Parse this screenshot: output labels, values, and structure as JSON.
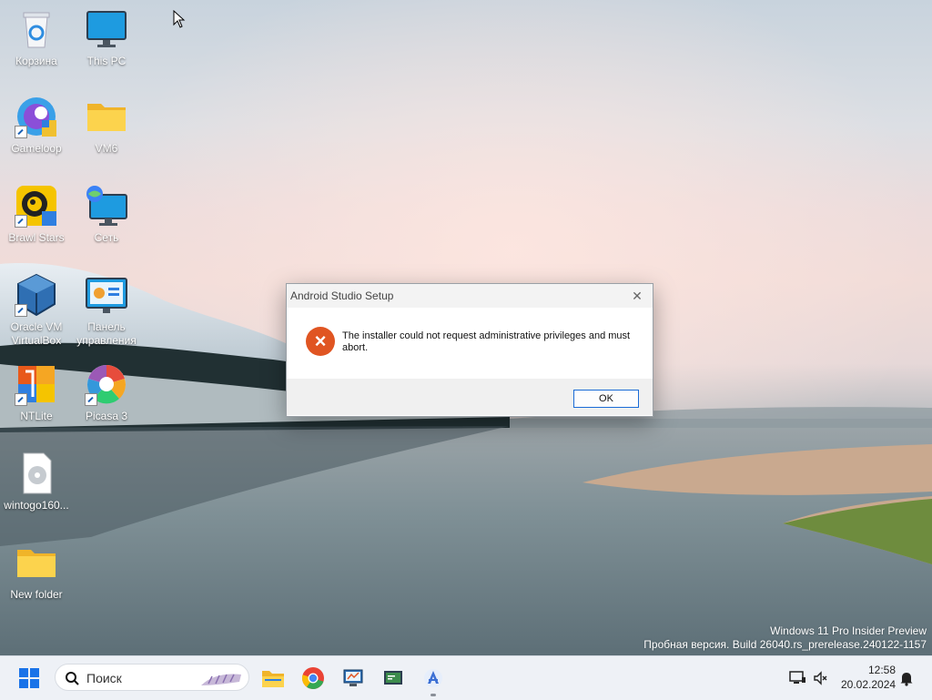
{
  "desktop": {
    "icons": [
      {
        "label": "Корзина",
        "icon": "recycle-bin-icon"
      },
      {
        "label": "This PC",
        "icon": "monitor-icon"
      },
      {
        "label": "Gameloop",
        "icon": "gameloop-icon"
      },
      {
        "label": "VM6",
        "icon": "folder-icon"
      },
      {
        "label": "Brawl Stars",
        "icon": "brawl-stars-icon"
      },
      {
        "label": "Сеть",
        "icon": "network-icon"
      },
      {
        "label": "Oracle VM VirtualBox",
        "icon": "virtualbox-icon"
      },
      {
        "label": "Панель управления",
        "icon": "control-panel-icon"
      },
      {
        "label": "NTLite",
        "icon": "ntlite-icon"
      },
      {
        "label": "Picasa 3",
        "icon": "picasa-icon"
      },
      {
        "label": "wintogo160...",
        "icon": "disc-image-file-icon"
      },
      {
        "label": "New folder",
        "icon": "folder-icon"
      }
    ],
    "watermark": {
      "line1": "Windows 11 Pro Insider Preview",
      "line2": "Пробная версия. Build 26040.rs_prerelease.240122-1157"
    }
  },
  "dialog": {
    "title": "Android Studio Setup",
    "message": "The installer could not request administrative privileges and must abort.",
    "ok_label": "OK"
  },
  "taskbar": {
    "search_label": "Поиск",
    "apps": [
      "start-icon",
      "file-explorer-icon",
      "chrome-icon",
      "remote-app-icon",
      "terminal-app-icon",
      "android-studio-installer-icon"
    ],
    "clock_time": "12:58",
    "clock_date": "20.02.2024"
  },
  "colors": {
    "accent": "#1a6bd6",
    "error": "#e05522"
  }
}
